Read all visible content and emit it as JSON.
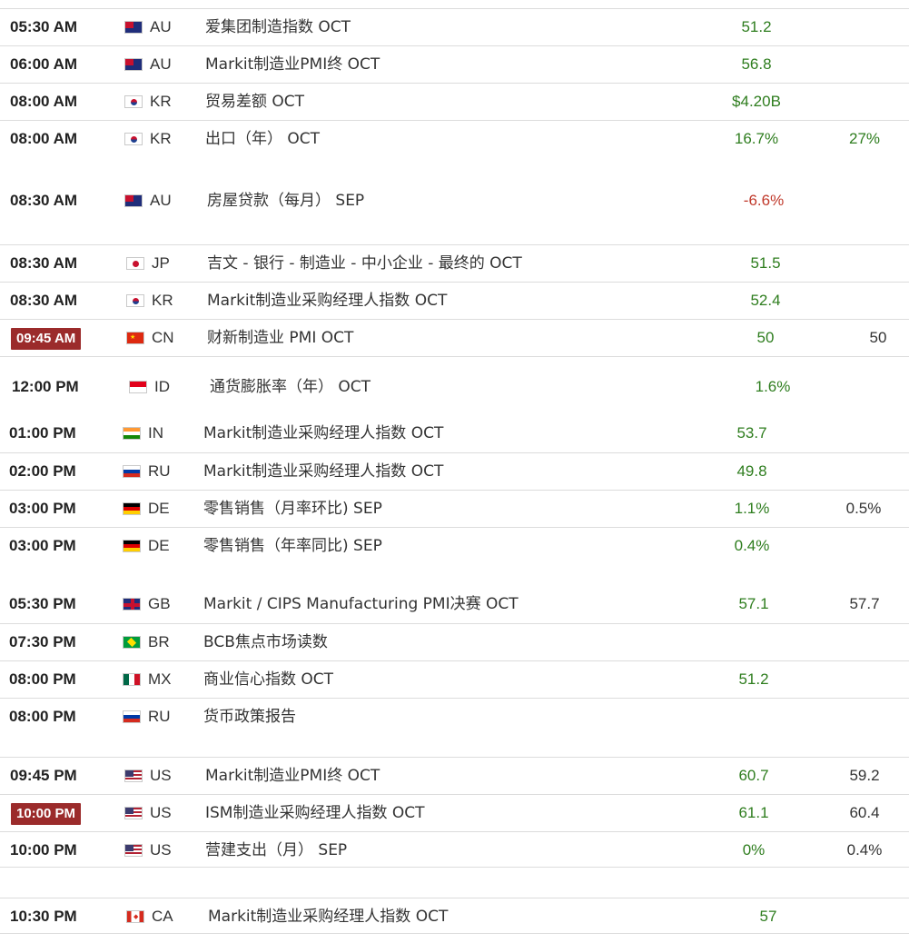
{
  "rows": [
    {
      "time": "05:30 AM",
      "country": "AU",
      "flag": "au-flag-icon",
      "event": "爱集团制造指数 OCT",
      "actual": "51.2",
      "forecast": ""
    },
    {
      "time": "06:00 AM",
      "country": "AU",
      "flag": "au-flag-icon",
      "event": "Markit制造业PMI终 OCT",
      "actual": "56.8",
      "forecast": ""
    },
    {
      "time": "08:00 AM",
      "country": "KR",
      "flag": "kr-flag-icon",
      "event": "贸易差额 OCT",
      "actual": "$4.20B",
      "forecast": ""
    },
    {
      "time": "08:00 AM",
      "country": "KR",
      "flag": "kr-flag-icon",
      "event": "出口（年） OCT",
      "actual": "16.7%",
      "forecast": "27%"
    },
    {
      "time": "08:30 AM",
      "country": "AU",
      "flag": "au-flag-icon",
      "event": "房屋贷款（每月） SEP",
      "actual": "-6.6%",
      "forecast": ""
    },
    {
      "time": "08:30 AM",
      "country": "JP",
      "flag": "jp-flag-icon",
      "event": "吉文 - 银行 - 制造业 - 中小企业 - 最终的 OCT",
      "actual": "51.5",
      "forecast": ""
    },
    {
      "time": "08:30 AM",
      "country": "KR",
      "flag": "kr-flag-icon",
      "event": "Markit制造业采购经理人指数 OCT",
      "actual": "52.4",
      "forecast": ""
    },
    {
      "time": "09:45 AM",
      "country": "CN",
      "flag": "cn-flag-icon",
      "event": "财新制造业 PMI OCT",
      "actual": "50",
      "forecast": "50"
    },
    {
      "time": "12:00 PM",
      "country": "ID",
      "flag": "id-flag-icon",
      "event": "通货膨胀率（年） OCT",
      "actual": "1.6%",
      "forecast": ""
    },
    {
      "time": "01:00 PM",
      "country": "IN",
      "flag": "in-flag-icon",
      "event": "Markit制造业采购经理人指数 OCT",
      "actual": "53.7",
      "forecast": ""
    },
    {
      "time": "02:00 PM",
      "country": "RU",
      "flag": "ru-flag-icon",
      "event": "Markit制造业采购经理人指数 OCT",
      "actual": "49.8",
      "forecast": ""
    },
    {
      "time": "03:00 PM",
      "country": "DE",
      "flag": "de-flag-icon",
      "event": "零售销售（月率环比) SEP",
      "actual": "1.1%",
      "forecast": "0.5%"
    },
    {
      "time": "03:00 PM",
      "country": "DE",
      "flag": "de-flag-icon",
      "event": "零售销售（年率同比) SEP",
      "actual": "0.4%",
      "forecast": ""
    },
    {
      "time": "05:30 PM",
      "country": "GB",
      "flag": "gb-flag-icon",
      "event": "Markit / CIPS Manufacturing PMI决赛 OCT",
      "actual": "57.1",
      "forecast": "57.7"
    },
    {
      "time": "07:30 PM",
      "country": "BR",
      "flag": "br-flag-icon",
      "event": "BCB焦点市场读数",
      "actual": "",
      "forecast": ""
    },
    {
      "time": "08:00 PM",
      "country": "MX",
      "flag": "mx-flag-icon",
      "event": "商业信心指数 OCT",
      "actual": "51.2",
      "forecast": ""
    },
    {
      "time": "08:00 PM",
      "country": "RU",
      "flag": "ru-flag-icon",
      "event": "货币政策报告",
      "actual": "",
      "forecast": ""
    },
    {
      "time": "09:45 PM",
      "country": "US",
      "flag": "us-flag-icon",
      "event": "Markit制造业PMI终 OCT",
      "actual": "60.7",
      "forecast": "59.2"
    },
    {
      "time": "10:00 PM",
      "country": "US",
      "flag": "us-flag-icon",
      "event": "ISM制造业采购经理人指数 OCT",
      "actual": "61.1",
      "forecast": "60.4"
    },
    {
      "time": "10:00 PM",
      "country": "US",
      "flag": "us-flag-icon",
      "event": "营建支出（月） SEP",
      "actual": "0%",
      "forecast": "0.4%"
    },
    {
      "time": "10:30 PM",
      "country": "CA",
      "flag": "ca-flag-icon",
      "event": "Markit制造业采购经理人指数 OCT",
      "actual": "57",
      "forecast": ""
    }
  ],
  "colors": {
    "actual_positive": "#2e7d1e",
    "actual_negative": "#c0392b",
    "highlight_badge": "#9b2b2b"
  }
}
